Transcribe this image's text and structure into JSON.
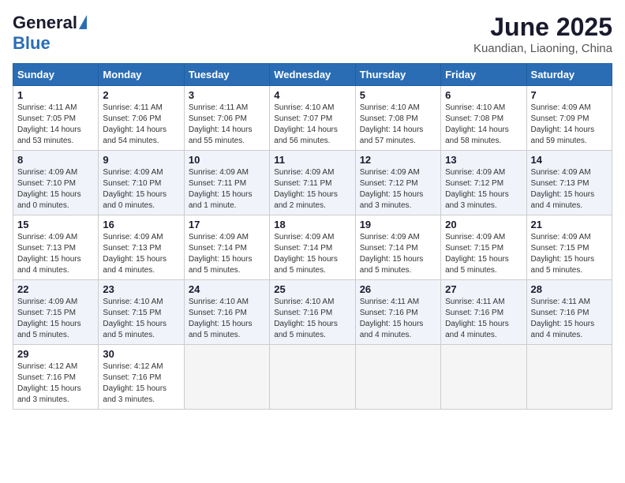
{
  "header": {
    "logo_general": "General",
    "logo_blue": "Blue",
    "title": "June 2025",
    "subtitle": "Kuandian, Liaoning, China"
  },
  "calendar": {
    "days_of_week": [
      "Sunday",
      "Monday",
      "Tuesday",
      "Wednesday",
      "Thursday",
      "Friday",
      "Saturday"
    ],
    "weeks": [
      [
        null,
        {
          "day": "2",
          "sunrise": "4:11 AM",
          "sunset": "7:06 PM",
          "daylight": "14 hours and 54 minutes."
        },
        {
          "day": "3",
          "sunrise": "4:11 AM",
          "sunset": "7:06 PM",
          "daylight": "14 hours and 55 minutes."
        },
        {
          "day": "4",
          "sunrise": "4:10 AM",
          "sunset": "7:07 PM",
          "daylight": "14 hours and 56 minutes."
        },
        {
          "day": "5",
          "sunrise": "4:10 AM",
          "sunset": "7:08 PM",
          "daylight": "14 hours and 57 minutes."
        },
        {
          "day": "6",
          "sunrise": "4:10 AM",
          "sunset": "7:08 PM",
          "daylight": "14 hours and 58 minutes."
        },
        {
          "day": "7",
          "sunrise": "4:09 AM",
          "sunset": "7:09 PM",
          "daylight": "14 hours and 59 minutes."
        }
      ],
      [
        {
          "day": "1",
          "sunrise": "4:11 AM",
          "sunset": "7:05 PM",
          "daylight": "14 hours and 53 minutes."
        },
        {
          "day": "9",
          "sunrise": "4:09 AM",
          "sunset": "7:10 PM",
          "daylight": "15 hours and 0 minutes."
        },
        {
          "day": "10",
          "sunrise": "4:09 AM",
          "sunset": "7:11 PM",
          "daylight": "15 hours and 1 minute."
        },
        {
          "day": "11",
          "sunrise": "4:09 AM",
          "sunset": "7:11 PM",
          "daylight": "15 hours and 2 minutes."
        },
        {
          "day": "12",
          "sunrise": "4:09 AM",
          "sunset": "7:12 PM",
          "daylight": "15 hours and 3 minutes."
        },
        {
          "day": "13",
          "sunrise": "4:09 AM",
          "sunset": "7:12 PM",
          "daylight": "15 hours and 3 minutes."
        },
        {
          "day": "14",
          "sunrise": "4:09 AM",
          "sunset": "7:13 PM",
          "daylight": "15 hours and 4 minutes."
        }
      ],
      [
        {
          "day": "8",
          "sunrise": "4:09 AM",
          "sunset": "7:10 PM",
          "daylight": "15 hours and 0 minutes."
        },
        {
          "day": "16",
          "sunrise": "4:09 AM",
          "sunset": "7:13 PM",
          "daylight": "15 hours and 4 minutes."
        },
        {
          "day": "17",
          "sunrise": "4:09 AM",
          "sunset": "7:14 PM",
          "daylight": "15 hours and 5 minutes."
        },
        {
          "day": "18",
          "sunrise": "4:09 AM",
          "sunset": "7:14 PM",
          "daylight": "15 hours and 5 minutes."
        },
        {
          "day": "19",
          "sunrise": "4:09 AM",
          "sunset": "7:14 PM",
          "daylight": "15 hours and 5 minutes."
        },
        {
          "day": "20",
          "sunrise": "4:09 AM",
          "sunset": "7:15 PM",
          "daylight": "15 hours and 5 minutes."
        },
        {
          "day": "21",
          "sunrise": "4:09 AM",
          "sunset": "7:15 PM",
          "daylight": "15 hours and 5 minutes."
        }
      ],
      [
        {
          "day": "15",
          "sunrise": "4:09 AM",
          "sunset": "7:13 PM",
          "daylight": "15 hours and 4 minutes."
        },
        {
          "day": "23",
          "sunrise": "4:10 AM",
          "sunset": "7:15 PM",
          "daylight": "15 hours and 5 minutes."
        },
        {
          "day": "24",
          "sunrise": "4:10 AM",
          "sunset": "7:16 PM",
          "daylight": "15 hours and 5 minutes."
        },
        {
          "day": "25",
          "sunrise": "4:10 AM",
          "sunset": "7:16 PM",
          "daylight": "15 hours and 5 minutes."
        },
        {
          "day": "26",
          "sunrise": "4:11 AM",
          "sunset": "7:16 PM",
          "daylight": "15 hours and 4 minutes."
        },
        {
          "day": "27",
          "sunrise": "4:11 AM",
          "sunset": "7:16 PM",
          "daylight": "15 hours and 4 minutes."
        },
        {
          "day": "28",
          "sunrise": "4:11 AM",
          "sunset": "7:16 PM",
          "daylight": "15 hours and 4 minutes."
        }
      ],
      [
        {
          "day": "22",
          "sunrise": "4:09 AM",
          "sunset": "7:15 PM",
          "daylight": "15 hours and 5 minutes."
        },
        {
          "day": "30",
          "sunrise": "4:12 AM",
          "sunset": "7:16 PM",
          "daylight": "15 hours and 3 minutes."
        },
        null,
        null,
        null,
        null,
        null
      ],
      [
        {
          "day": "29",
          "sunrise": "4:12 AM",
          "sunset": "7:16 PM",
          "daylight": "15 hours and 3 minutes."
        },
        null,
        null,
        null,
        null,
        null,
        null
      ]
    ]
  }
}
